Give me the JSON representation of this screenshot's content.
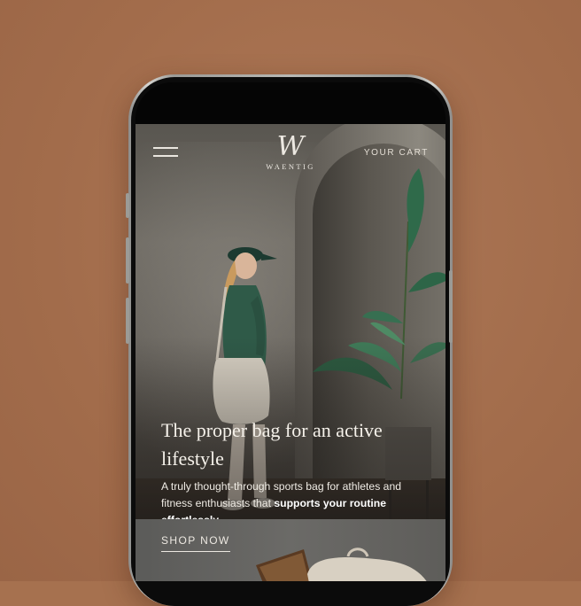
{
  "brand": {
    "monogram": "W",
    "name": "WAENTIG"
  },
  "header": {
    "cart_label": "YOUR CART"
  },
  "hero": {
    "headline": "The proper bag for an active lifestyle",
    "subcopy_lead": "A truly thought-through sports bag for athletes and fitness enthusiasts that ",
    "subcopy_emphasis": "supports your routine effortlessly."
  },
  "cta": {
    "shop_label": "SHOP NOW"
  },
  "icons": {
    "menu": "hamburger-menu-icon"
  },
  "colors": {
    "backdrop": "#a6714f",
    "text_light": "#f5f1ea",
    "jacket_green": "#2f5a48"
  }
}
